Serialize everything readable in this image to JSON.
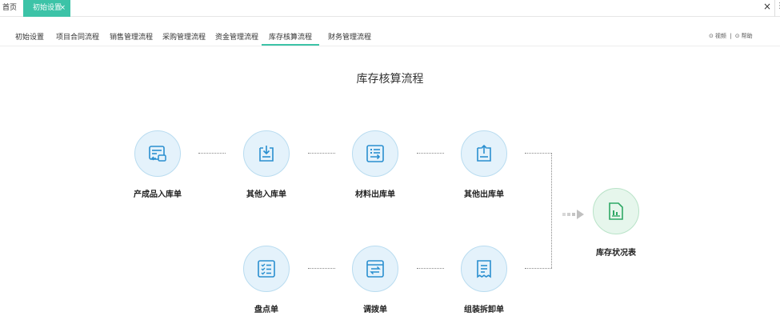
{
  "topbar": {
    "home_tab": "首页",
    "active_tab": "初始设置",
    "active_close": "×",
    "close_icon": "×",
    "more_icon": "⋮"
  },
  "nav": {
    "items": [
      "初始设置",
      "项目合同流程",
      "销售管理流程",
      "采购管理流程",
      "资金管理流程",
      "库存核算流程",
      "财务管理流程"
    ],
    "active_index": 5,
    "video": "视频",
    "separator": "|",
    "help": "帮助"
  },
  "page_title": "库存核算流程",
  "nodes": {
    "product_in": "产成品入库单",
    "other_in": "其他入库单",
    "material_out": "材料出库单",
    "other_out": "其他出库单",
    "stock_check": "盘点单",
    "transfer": "调拨单",
    "assembly": "组装拆卸单",
    "stock_status": "库存状况表"
  },
  "colors": {
    "accent": "#3cc3a7",
    "icon_blue": "#2a8fd0",
    "icon_green": "#2fa866",
    "node_bg_blue": "#e4f2fb",
    "node_bg_green": "#e6f6ec"
  }
}
